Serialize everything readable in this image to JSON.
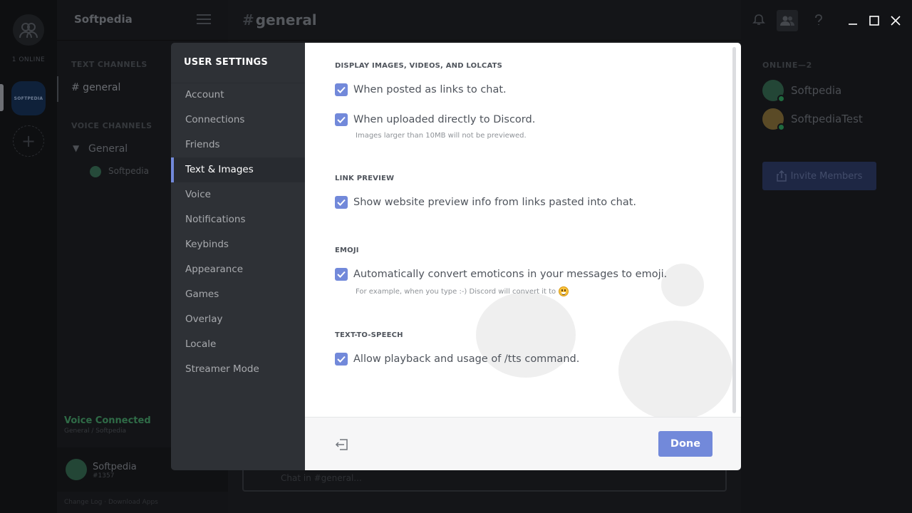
{
  "background": {
    "guild_bar": {
      "online_label": "1 ONLINE",
      "server_icon_label": "SOFTPEDIA",
      "add_server_label": "+"
    },
    "channels": {
      "server_name": "Softpedia",
      "text_category": "TEXT CHANNELS",
      "text_channel": "# general",
      "voice_category": "VOICE CHANNELS",
      "voice_channel": "General",
      "voice_user": "Softpedia",
      "voice_status": "Voice Connected",
      "voice_status_sub": "General / Softpedia",
      "user_name": "Softpedia",
      "user_tag": "#1357",
      "bottom_links": "Change Log  ·  Download Apps"
    },
    "main": {
      "hash": "#",
      "channel_title": "general",
      "input_placeholder": "Chat in #general..."
    },
    "members": {
      "online_header": "ONLINE—2",
      "list": [
        {
          "name": "Softpedia",
          "color": "#234636"
        },
        {
          "name": "SoftpediaTest",
          "color": "#5a4a26"
        }
      ],
      "invite_label": "Invite Members"
    }
  },
  "settings": {
    "title": "USER SETTINGS",
    "nav": [
      {
        "label": "Account",
        "active": false
      },
      {
        "label": "Connections",
        "active": false
      },
      {
        "label": "Friends",
        "active": false
      },
      {
        "label": "Text & Images",
        "active": true
      },
      {
        "label": "Voice",
        "active": false
      },
      {
        "label": "Notifications",
        "active": false
      },
      {
        "label": "Keybinds",
        "active": false
      },
      {
        "label": "Appearance",
        "active": false
      },
      {
        "label": "Games",
        "active": false
      },
      {
        "label": "Overlay",
        "active": false
      },
      {
        "label": "Locale",
        "active": false
      },
      {
        "label": "Streamer Mode",
        "active": false
      }
    ],
    "sections": {
      "display": {
        "heading": "DISPLAY IMAGES, VIDEOS, AND LOLCATS",
        "opt1": "When posted as links to chat.",
        "opt2": "When uploaded directly to Discord.",
        "hint": "Images larger than 10MB will not be previewed."
      },
      "link_preview": {
        "heading": "LINK PREVIEW",
        "opt1": "Show website preview info from links pasted into chat."
      },
      "emoji": {
        "heading": "EMOJI",
        "opt1": "Automatically convert emoticons in your messages to emoji.",
        "hint": "For example, when you type :-) Discord will convert it to"
      },
      "tts": {
        "heading": "TEXT-TO-SPEECH",
        "opt1": "Allow playback and usage of /tts command."
      }
    },
    "checkboxes": {
      "display_links": true,
      "display_uploads": true,
      "link_preview": true,
      "emoji_convert": true,
      "tts": true
    },
    "done_label": "Done",
    "accent_color": "#7289da"
  }
}
